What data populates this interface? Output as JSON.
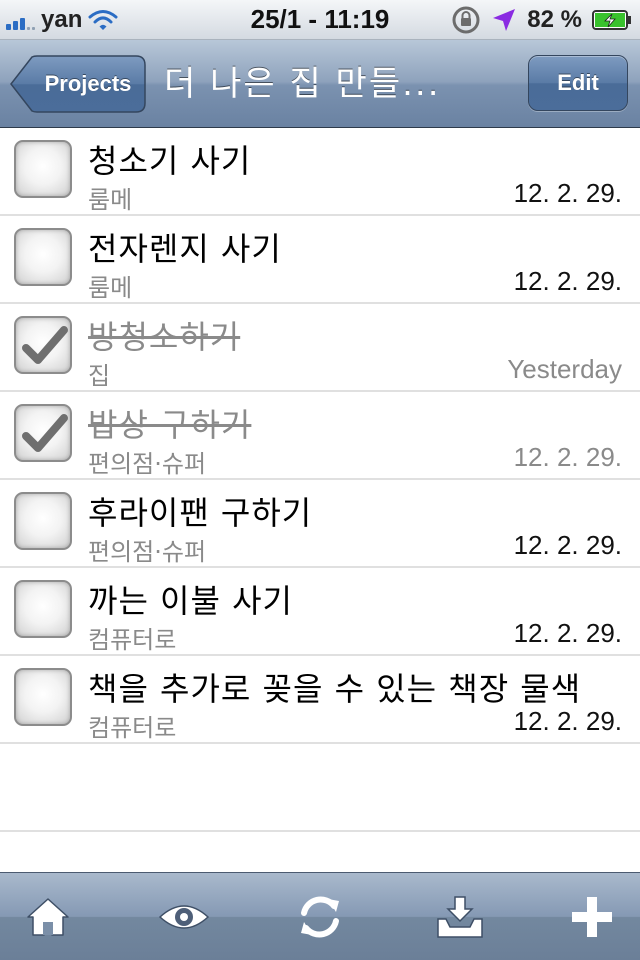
{
  "status_bar": {
    "carrier": "yan",
    "time": "25/1 - 11:19",
    "battery_percent": "82 %"
  },
  "nav": {
    "back_label": "Projects",
    "title": "더 나은 집 만들...",
    "edit_label": "Edit"
  },
  "tasks": [
    {
      "title": "청소기 사기",
      "context": "룸메",
      "date": "12. 2. 29.",
      "done": false
    },
    {
      "title": "전자렌지 사기",
      "context": "룸메",
      "date": "12. 2. 29.",
      "done": false
    },
    {
      "title": "방청소하기",
      "context": "집",
      "date": "Yesterday",
      "done": true
    },
    {
      "title": "밥상 구하기",
      "context": "편의점·슈퍼",
      "date": "12. 2. 29.",
      "done": true
    },
    {
      "title": "후라이팬 구하기",
      "context": "편의점·슈퍼",
      "date": "12. 2. 29.",
      "done": false
    },
    {
      "title": "까는 이불 사기",
      "context": "컴퓨터로",
      "date": "12. 2. 29.",
      "done": false
    },
    {
      "title": "책을 추가로 꽂을 수 있는 책장 물색",
      "context": "컴퓨터로",
      "date": "12. 2. 29.",
      "done": false
    }
  ],
  "tab_bar": {
    "icons": [
      "home-icon",
      "eye-icon",
      "sync-icon",
      "inbox-icon",
      "plus-icon"
    ]
  },
  "colors": {
    "nav_bar": "#8ea2bc",
    "edit_button": "#5a7ba6",
    "done_text": "#8a8a8a"
  }
}
